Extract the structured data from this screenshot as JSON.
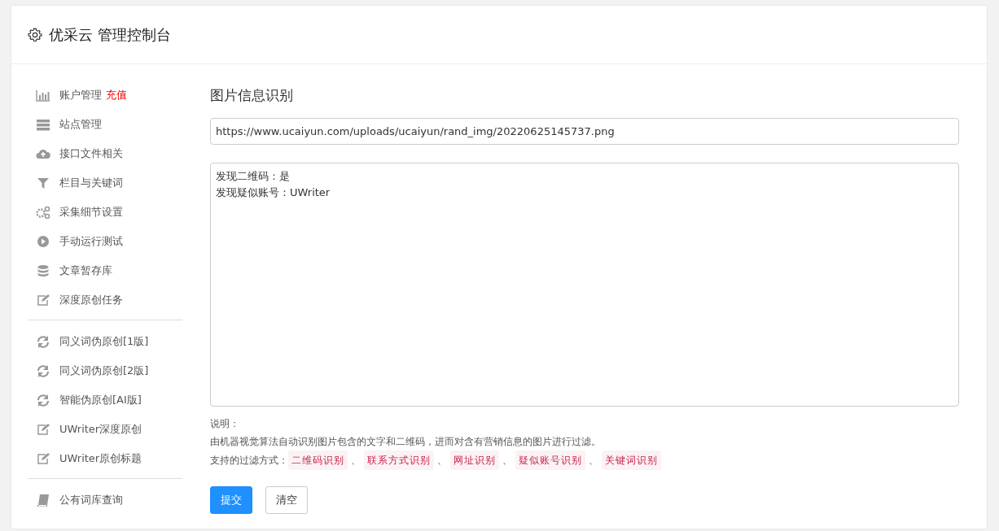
{
  "header": {
    "title": "优采云 管理控制台"
  },
  "sidebar": {
    "groups": [
      [
        {
          "kind": "chart",
          "label": "账户管理",
          "badge": "充值"
        },
        {
          "kind": "server",
          "label": "站点管理"
        },
        {
          "kind": "cloud",
          "label": "接口文件相关"
        },
        {
          "kind": "filter",
          "label": "栏目与关键词"
        },
        {
          "kind": "gears",
          "label": "采集细节设置"
        },
        {
          "kind": "play",
          "label": "手动运行测试"
        },
        {
          "kind": "database",
          "label": "文章暂存库"
        },
        {
          "kind": "edit",
          "label": "深度原创任务"
        }
      ],
      [
        {
          "kind": "refresh",
          "label": "同义词伪原创[1版]"
        },
        {
          "kind": "refresh",
          "label": "同义词伪原创[2版]"
        },
        {
          "kind": "refresh",
          "label": "智能伪原创[AI版]"
        },
        {
          "kind": "edit",
          "label": "UWriter深度原创"
        },
        {
          "kind": "edit",
          "label": "UWriter原创标题"
        }
      ],
      [
        {
          "kind": "book",
          "label": "公有词库查询"
        }
      ]
    ]
  },
  "main": {
    "title": "图片信息识别",
    "url_field": {
      "value": "https://www.ucaiyun.com/uploads/ucaiyun/rand_img/20220625145737.png"
    },
    "result_box": {
      "lines": [
        "发现二维码：是",
        "发现疑似账号：UWriter"
      ]
    },
    "note_heading": "说明：",
    "note_text": "由机器视觉算法自动识别图片包含的文字和二维码，进而对含有营销信息的图片进行过滤。",
    "methods_label": "支持的过滤方式：",
    "methods": [
      "二维码识别",
      "联系方式识别",
      "网址识别",
      "疑似账号识别",
      "关键词识别"
    ],
    "separator": "、",
    "buttons": [
      {
        "kind": "primary",
        "label": "提交"
      },
      {
        "kind": "default",
        "label": "清空"
      }
    ]
  }
}
